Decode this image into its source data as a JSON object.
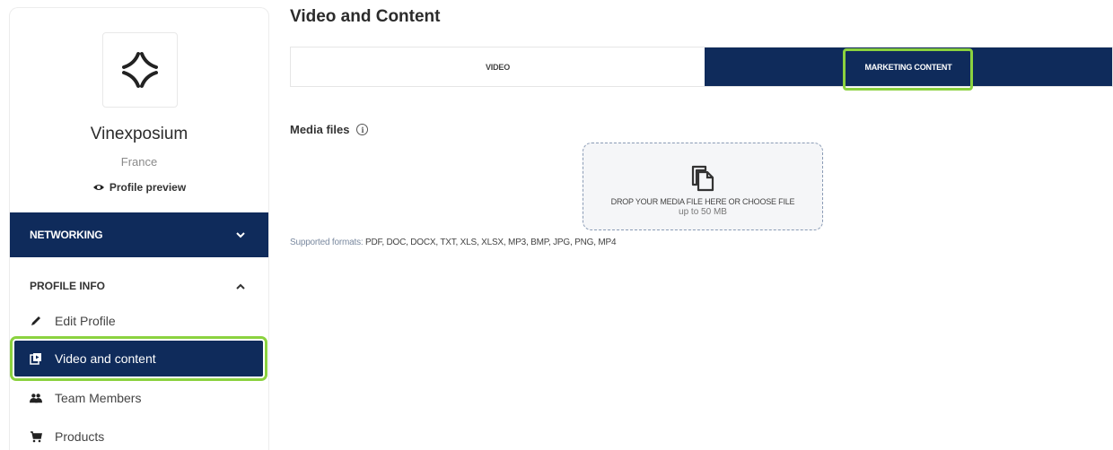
{
  "sidebar": {
    "org_name": "Vinexposium",
    "country": "France",
    "profile_preview": "Profile preview",
    "networking_label": "NETWORKING",
    "profile_info_label": "PROFILE INFO",
    "menu": [
      {
        "label": "Edit Profile",
        "icon": "pencil-icon"
      },
      {
        "label": "Video and content",
        "icon": "media-library-icon",
        "active": true
      },
      {
        "label": "Team Members",
        "icon": "team-icon"
      },
      {
        "label": "Products",
        "icon": "cart-icon"
      }
    ]
  },
  "main": {
    "title": "Video and Content",
    "tabs": [
      {
        "label": "VIDEO",
        "active": false
      },
      {
        "label": "MARKETING CONTENT",
        "active": true
      }
    ],
    "media_files_label": "Media files",
    "dropzone_text": "DROP YOUR MEDIA FILE HERE OR CHOOSE FILE",
    "dropzone_size": "up to 50 MB",
    "formats_label": "Supported formats:",
    "formats_value": "PDF, DOC, DOCX, TXT, XLS, XLSX, MP3, BMP, JPG, PNG, MP4"
  },
  "colors": {
    "navy": "#0f2b5b",
    "highlight": "#8bd23f"
  }
}
